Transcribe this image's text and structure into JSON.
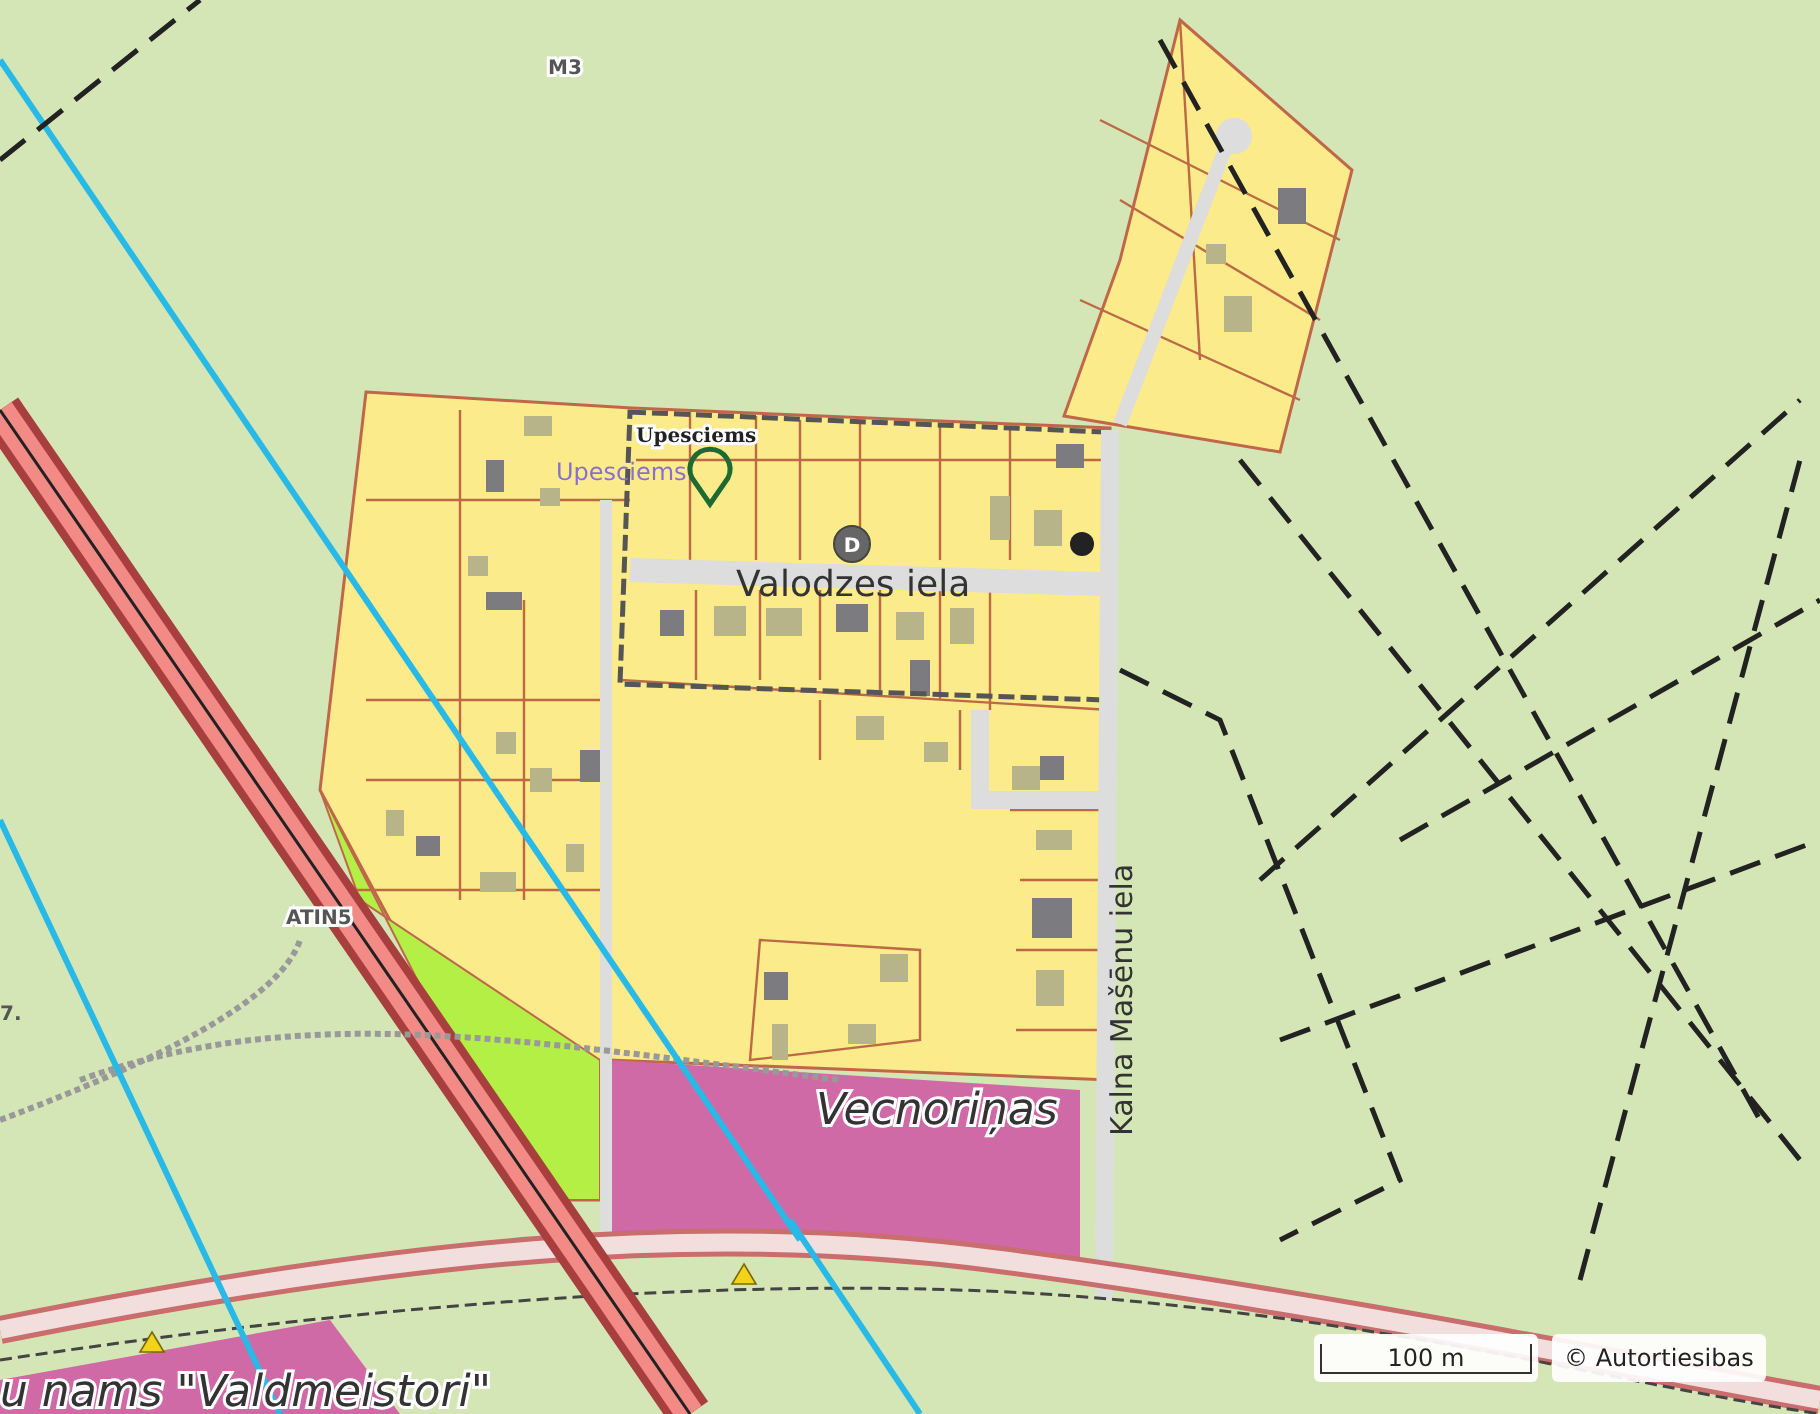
{
  "map": {
    "labels": [
      {
        "kind": "road-ref",
        "text": "M3"
      },
      {
        "kind": "place",
        "text": "Upesciems"
      },
      {
        "kind": "place-alt",
        "text": "Upesciems"
      },
      {
        "kind": "street",
        "text": "Valodzes iela"
      },
      {
        "kind": "street-vertical",
        "text": "Kalna Mašēnu iela"
      },
      {
        "kind": "area",
        "text": "Vecnoriņas"
      },
      {
        "kind": "road-ref",
        "text": "ATIN5"
      },
      {
        "kind": "edge",
        "text": "7."
      },
      {
        "kind": "area",
        "text": "u nams \"Valdmeistori\""
      }
    ],
    "badge": {
      "text": "D"
    }
  },
  "scale_bar": {
    "text": "100 m"
  },
  "attribution": {
    "text": "© Autortiesibas"
  }
}
